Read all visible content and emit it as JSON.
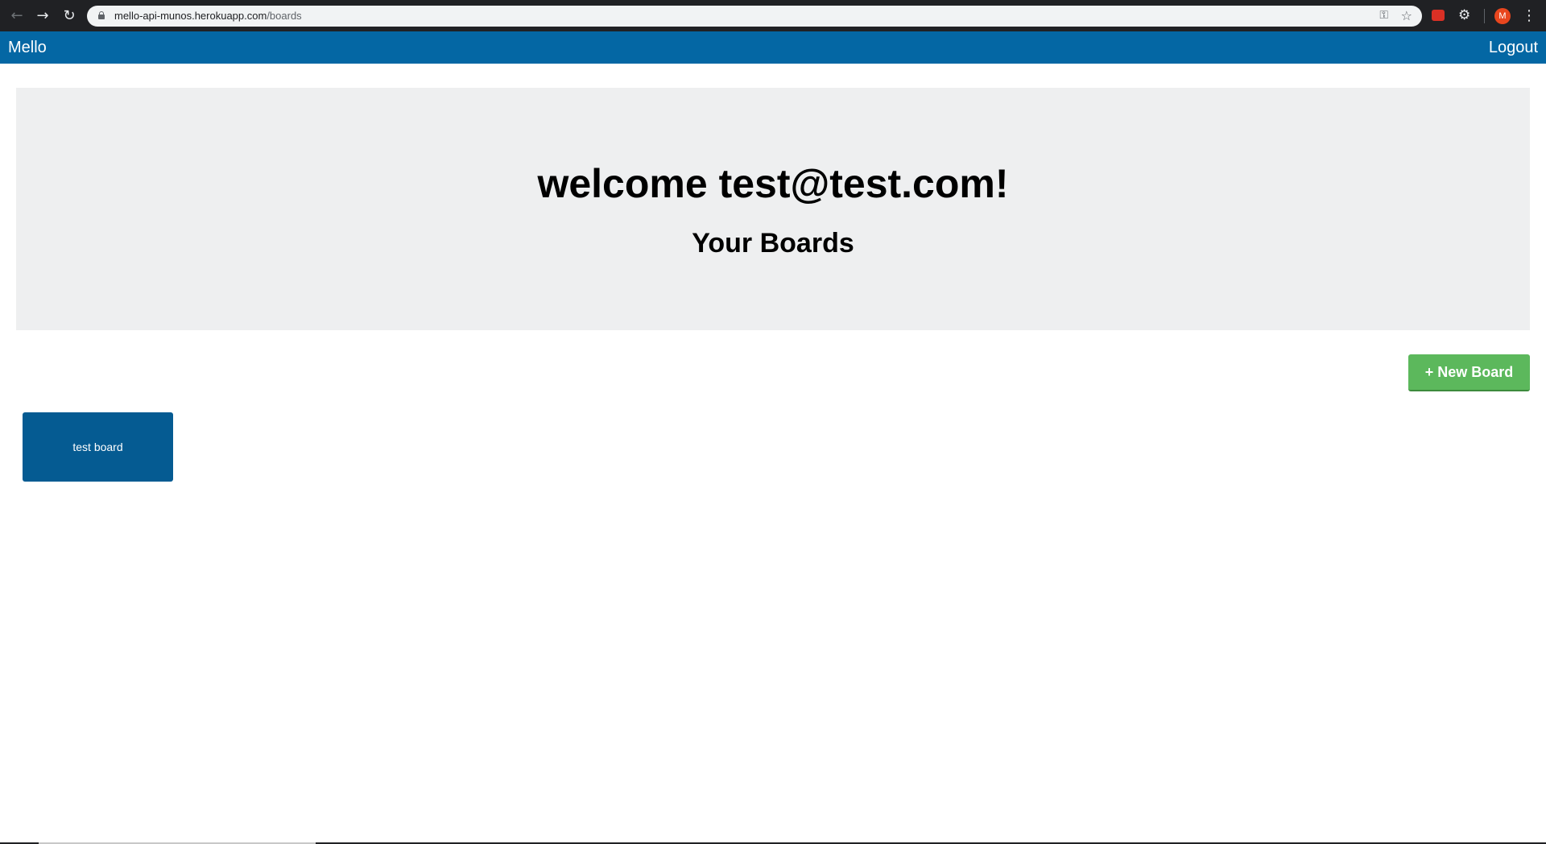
{
  "browser": {
    "url_host": "mello-api-munos.herokuapp.com",
    "url_path": "/boards",
    "icons": {
      "back": "back-arrow-icon",
      "forward": "forward-arrow-icon",
      "reload": "reload-icon",
      "lock": "lock-icon",
      "key": "key-icon",
      "star": "star-icon",
      "menu": "more-vertical-icon"
    },
    "avatar_initial": "M"
  },
  "navbar": {
    "brand": "Mello",
    "logout": "Logout",
    "color": "#0467a4"
  },
  "jumbotron": {
    "welcome": "welcome test@test.com!",
    "subtitle": "Your Boards",
    "background": "#eeeff0"
  },
  "actions": {
    "new_board": "+ New Board",
    "color": "#5cb85c"
  },
  "boards": [
    {
      "title": "test board",
      "color": "#055b92"
    }
  ]
}
